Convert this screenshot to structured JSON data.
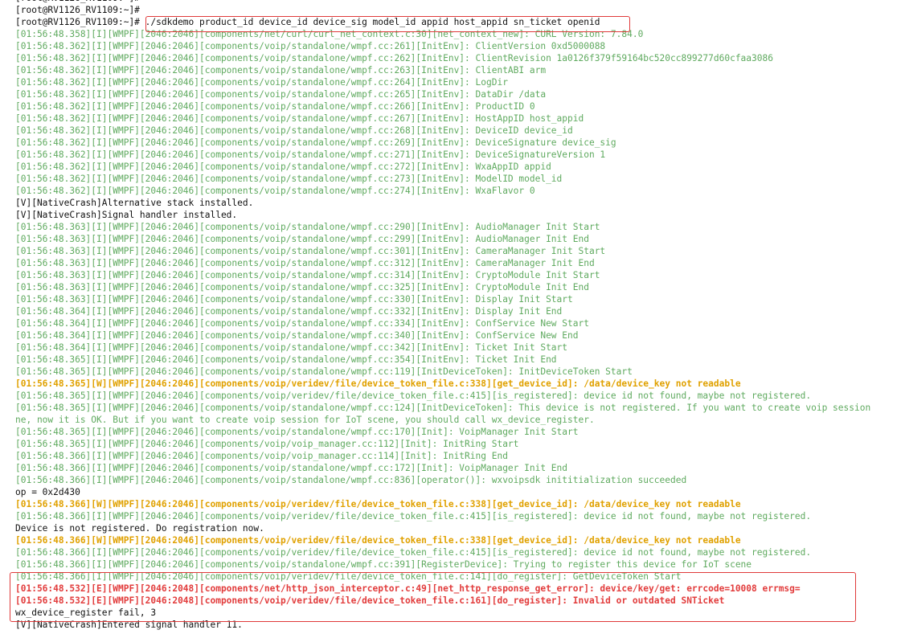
{
  "terminal": {
    "lines": [
      {
        "level": "plain",
        "text": "[root@RV1126_RV1109:~]#"
      },
      {
        "level": "plain",
        "text": "[root@RV1126_RV1109:~]#"
      },
      {
        "level": "plain",
        "text": "[root@RV1126_RV1109:~]# ./sdkdemo product_id device_id device_sig model_id appid host_appid sn_ticket openid"
      },
      {
        "level": "info",
        "text": "[01:56:48.358][I][WMPF][2046:2046][components/net/curl/curl_net_context.c:30][net_context_new]: CURL Version: 7.84.0"
      },
      {
        "level": "info",
        "text": "[01:56:48.362][I][WMPF][2046:2046][components/voip/standalone/wmpf.cc:261][InitEnv]: ClientVersion 0xd5000088"
      },
      {
        "level": "info",
        "text": "[01:56:48.362][I][WMPF][2046:2046][components/voip/standalone/wmpf.cc:262][InitEnv]: ClientRevision 1a0126f379f59164bc520cc899277d60cfaa3086"
      },
      {
        "level": "info",
        "text": "[01:56:48.362][I][WMPF][2046:2046][components/voip/standalone/wmpf.cc:263][InitEnv]: ClientABI arm"
      },
      {
        "level": "info",
        "text": "[01:56:48.362][I][WMPF][2046:2046][components/voip/standalone/wmpf.cc:264][InitEnv]: LogDir"
      },
      {
        "level": "info",
        "text": "[01:56:48.362][I][WMPF][2046:2046][components/voip/standalone/wmpf.cc:265][InitEnv]: DataDir /data"
      },
      {
        "level": "info",
        "text": "[01:56:48.362][I][WMPF][2046:2046][components/voip/standalone/wmpf.cc:266][InitEnv]: ProductID 0"
      },
      {
        "level": "info",
        "text": "[01:56:48.362][I][WMPF][2046:2046][components/voip/standalone/wmpf.cc:267][InitEnv]: HostAppID host_appid"
      },
      {
        "level": "info",
        "text": "[01:56:48.362][I][WMPF][2046:2046][components/voip/standalone/wmpf.cc:268][InitEnv]: DeviceID device_id"
      },
      {
        "level": "info",
        "text": "[01:56:48.362][I][WMPF][2046:2046][components/voip/standalone/wmpf.cc:269][InitEnv]: DeviceSignature device_sig"
      },
      {
        "level": "info",
        "text": "[01:56:48.362][I][WMPF][2046:2046][components/voip/standalone/wmpf.cc:271][InitEnv]: DeviceSignatureVersion 1"
      },
      {
        "level": "info",
        "text": "[01:56:48.362][I][WMPF][2046:2046][components/voip/standalone/wmpf.cc:272][InitEnv]: WxaAppID appid"
      },
      {
        "level": "info",
        "text": "[01:56:48.362][I][WMPF][2046:2046][components/voip/standalone/wmpf.cc:273][InitEnv]: ModelID model_id"
      },
      {
        "level": "info",
        "text": "[01:56:48.362][I][WMPF][2046:2046][components/voip/standalone/wmpf.cc:274][InitEnv]: WxaFlavor 0"
      },
      {
        "level": "plain",
        "text": "[V][NativeCrash]Alternative stack installed."
      },
      {
        "level": "plain",
        "text": "[V][NativeCrash]Signal handler installed."
      },
      {
        "level": "info",
        "text": "[01:56:48.363][I][WMPF][2046:2046][components/voip/standalone/wmpf.cc:290][InitEnv]: AudioManager Init Start"
      },
      {
        "level": "info",
        "text": "[01:56:48.363][I][WMPF][2046:2046][components/voip/standalone/wmpf.cc:299][InitEnv]: AudioManager Init End"
      },
      {
        "level": "info",
        "text": "[01:56:48.363][I][WMPF][2046:2046][components/voip/standalone/wmpf.cc:301][InitEnv]: CameraManager Init Start"
      },
      {
        "level": "info",
        "text": "[01:56:48.363][I][WMPF][2046:2046][components/voip/standalone/wmpf.cc:312][InitEnv]: CameraManager Init End"
      },
      {
        "level": "info",
        "text": "[01:56:48.363][I][WMPF][2046:2046][components/voip/standalone/wmpf.cc:314][InitEnv]: CryptoModule Init Start"
      },
      {
        "level": "info",
        "text": "[01:56:48.363][I][WMPF][2046:2046][components/voip/standalone/wmpf.cc:325][InitEnv]: CryptoModule Init End"
      },
      {
        "level": "info",
        "text": "[01:56:48.363][I][WMPF][2046:2046][components/voip/standalone/wmpf.cc:330][InitEnv]: Display Init Start"
      },
      {
        "level": "info",
        "text": "[01:56:48.364][I][WMPF][2046:2046][components/voip/standalone/wmpf.cc:332][InitEnv]: Display Init End"
      },
      {
        "level": "info",
        "text": "[01:56:48.364][I][WMPF][2046:2046][components/voip/standalone/wmpf.cc:334][InitEnv]: ConfService New Start"
      },
      {
        "level": "info",
        "text": "[01:56:48.364][I][WMPF][2046:2046][components/voip/standalone/wmpf.cc:340][InitEnv]: ConfService New End"
      },
      {
        "level": "info",
        "text": "[01:56:48.364][I][WMPF][2046:2046][components/voip/standalone/wmpf.cc:342][InitEnv]: Ticket Init Start"
      },
      {
        "level": "info",
        "text": "[01:56:48.365][I][WMPF][2046:2046][components/voip/standalone/wmpf.cc:354][InitEnv]: Ticket Init End"
      },
      {
        "level": "info",
        "text": "[01:56:48.365][I][WMPF][2046:2046][components/voip/standalone/wmpf.cc:119][InitDeviceToken]: InitDeviceToken Start"
      },
      {
        "level": "warn",
        "text": "[01:56:48.365][W][WMPF][2046:2046][components/voip/veridev/file/device_token_file.c:338][get_device_id]: /data/device_key not readable"
      },
      {
        "level": "info",
        "text": "[01:56:48.365][I][WMPF][2046:2046][components/voip/veridev/file/device_token_file.c:415][is_registered]: device id not found, maybe not registered."
      },
      {
        "level": "info",
        "text": "[01:56:48.365][I][WMPF][2046:2046][components/voip/standalone/wmpf.cc:124][InitDeviceToken]: This device is not registered. If you want to create voip session"
      },
      {
        "level": "info",
        "text": "ne, now it is OK. But if you want to create voip session for IoT scene, you should call wx_device_register."
      },
      {
        "level": "info",
        "text": "[01:56:48.365][I][WMPF][2046:2046][components/voip/standalone/wmpf.cc:170][Init]: VoipManager Init Start"
      },
      {
        "level": "info",
        "text": "[01:56:48.365][I][WMPF][2046:2046][components/voip/voip_manager.cc:112][Init]: InitRing Start"
      },
      {
        "level": "info",
        "text": "[01:56:48.366][I][WMPF][2046:2046][components/voip/voip_manager.cc:114][Init]: InitRing End"
      },
      {
        "level": "info",
        "text": "[01:56:48.366][I][WMPF][2046:2046][components/voip/standalone/wmpf.cc:172][Init]: VoipManager Init End"
      },
      {
        "level": "info",
        "text": "[01:56:48.366][I][WMPF][2046:2046][components/voip/standalone/wmpf.cc:836][operator()]: wxvoipsdk inititialization succeeded"
      },
      {
        "level": "plain",
        "text": "op = 0x2d430"
      },
      {
        "level": "warn",
        "text": "[01:56:48.366][W][WMPF][2046:2046][components/voip/veridev/file/device_token_file.c:338][get_device_id]: /data/device_key not readable"
      },
      {
        "level": "info",
        "text": "[01:56:48.366][I][WMPF][2046:2046][components/voip/veridev/file/device_token_file.c:415][is_registered]: device id not found, maybe not registered."
      },
      {
        "level": "plain",
        "text": "Device is not registered. Do registration now."
      },
      {
        "level": "warn",
        "text": "[01:56:48.366][W][WMPF][2046:2046][components/voip/veridev/file/device_token_file.c:338][get_device_id]: /data/device_key not readable"
      },
      {
        "level": "info",
        "text": "[01:56:48.366][I][WMPF][2046:2046][components/voip/veridev/file/device_token_file.c:415][is_registered]: device id not found, maybe not registered."
      },
      {
        "level": "info",
        "text": "[01:56:48.366][I][WMPF][2046:2046][components/voip/standalone/wmpf.cc:391][RegisterDevice]: Trying to register this device for IoT scene"
      },
      {
        "level": "info",
        "text": "[01:56:48.366][I][WMPF][2046:2046][components/voip/veridev/file/device_token_file.c:141][do_register]: GetDeviceToken Start"
      },
      {
        "level": "err",
        "text": "[01:56:48.532][E][WMPF][2046:2048][components/net/http_json_interceptor.c:49][net_http_response_get_error]: device/key/get: errcode=10008 errmsg="
      },
      {
        "level": "err",
        "text": "[01:56:48.532][E][WMPF][2046:2048][components/voip/veridev/file/device_token_file.c:161][do_register]: Invalid or outdated SNTicket"
      },
      {
        "level": "plain",
        "text": "wx_device_register fail, 3"
      },
      {
        "level": "plain",
        "text": "[V][NativeCrash]Entered signal handler 11."
      }
    ]
  },
  "colors": {
    "background": "#ffffff",
    "plain": "#111111",
    "info": "#5faa5f",
    "warn": "#e0a100",
    "error": "#e23c3c",
    "highlight_border": "#e03a3a"
  }
}
